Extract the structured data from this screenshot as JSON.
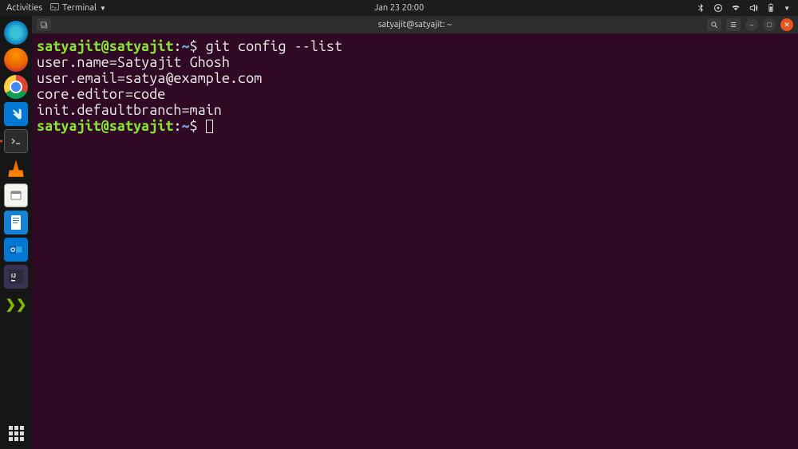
{
  "topbar": {
    "activities": "Activities",
    "app_indicator": "Terminal",
    "datetime": "Jan 23  20:00"
  },
  "dock": {
    "items": [
      {
        "name": "Microsoft Edge"
      },
      {
        "name": "Firefox"
      },
      {
        "name": "Google Chrome"
      },
      {
        "name": "Visual Studio Code"
      },
      {
        "name": "Terminal"
      },
      {
        "name": "VLC"
      },
      {
        "name": "Files"
      },
      {
        "name": "LibreOffice Writer"
      },
      {
        "name": "Outlook"
      },
      {
        "name": "IntelliJ IDEA"
      },
      {
        "name": "Sublime Merge"
      }
    ]
  },
  "window": {
    "title": "satyajit@satyajit: ~"
  },
  "terminal": {
    "prompt_user": "satyajit@satyajit",
    "prompt_sep": ":",
    "prompt_path": "~",
    "prompt_symbol": "$",
    "command": "git config --list",
    "output": [
      "user.name=Satyajit Ghosh",
      "user.email=satya@example.com",
      "core.editor=code",
      "init.defaultbranch=main"
    ]
  }
}
